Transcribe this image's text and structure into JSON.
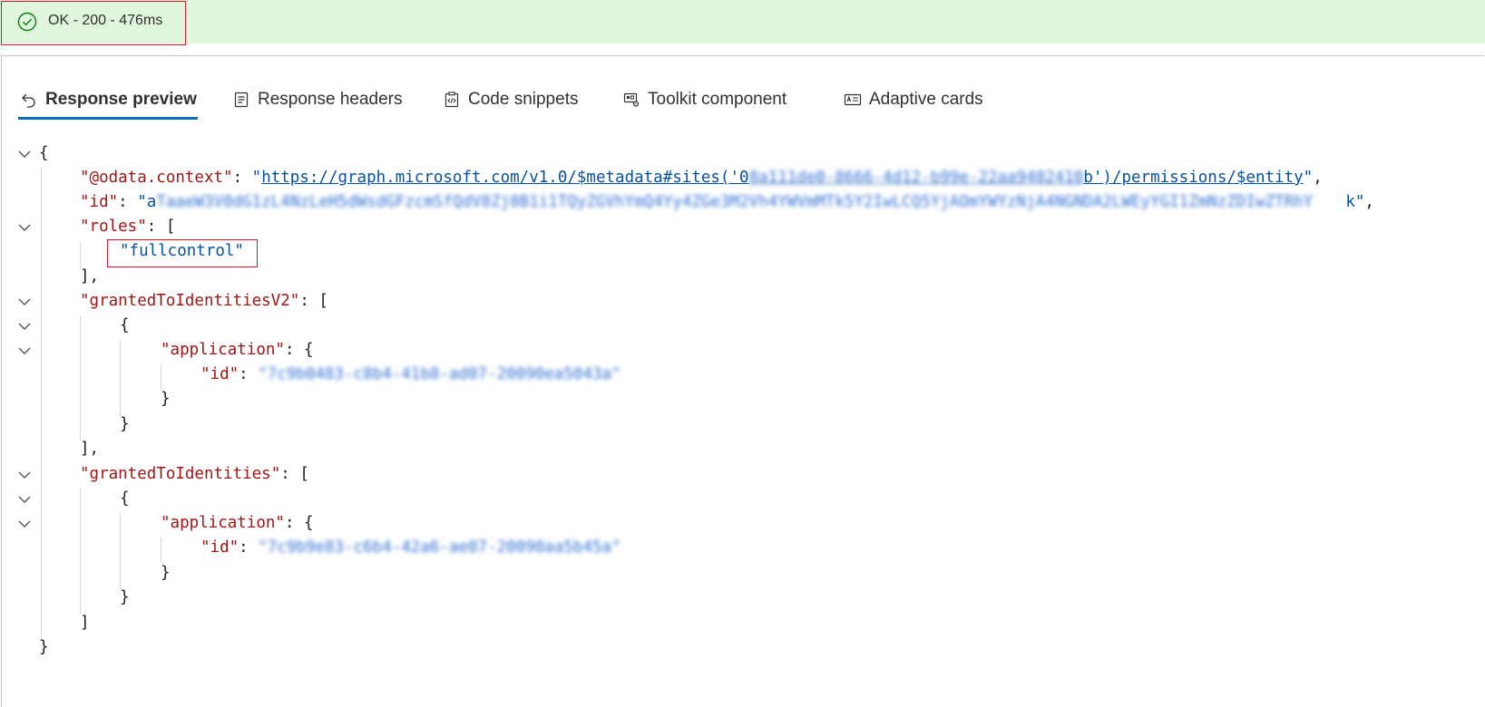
{
  "status": {
    "text": "OK - 200 - 476ms",
    "icon": "check-circle-icon",
    "color": "#107c10"
  },
  "tabs": [
    {
      "label": "Response preview",
      "icon": "undo-arrow-icon",
      "active": true
    },
    {
      "label": "Response headers",
      "icon": "document-list-icon"
    },
    {
      "label": "Code snippets",
      "icon": "clipboard-code-icon"
    },
    {
      "label": "Toolkit component",
      "icon": "component-gear-icon"
    },
    {
      "label": "Adaptive cards",
      "icon": "card-icon"
    }
  ],
  "json": {
    "odata_context_key": "\"@odata.context\"",
    "odata_context_prefix": "https://graph.microsoft.com/v1.0/$metadata#sites('0",
    "odata_context_redacted": "8a111de0-8666-4d12-b99e-22aa9402410",
    "odata_context_suffix": "b')/permissions/$entity",
    "id_key": "\"id\"",
    "id_prefix": "a",
    "id_redacted": "TaaeW3V0dG1zL4NzLeH5dWsdGFzcmSfQdV8Zj0B1i1TQyZGVhYmQ4Yy4ZGe3M2Vh4YWVmMTk5Y2IwLCQ5YjAOmYWYzNjA4NGNDA2LWEyYGI1ZmNzZDIwZTRhY",
    "id_suffix": "k",
    "roles_key": "\"roles\"",
    "roles_value": "\"fullcontrol\"",
    "granted_v2_key": "\"grantedToIdentitiesV2\"",
    "granted_key": "\"grantedToIdentities\"",
    "application_key": "\"application\"",
    "app_id_key": "\"id\"",
    "app_id_v2_redacted": "\"7c9b0483-c8b4-41b8-ad07-20090ea5043a\"",
    "app_id_redacted": "\"7c9b9e83-c6b4-42a6-ae07-20090aa5b45a\""
  }
}
